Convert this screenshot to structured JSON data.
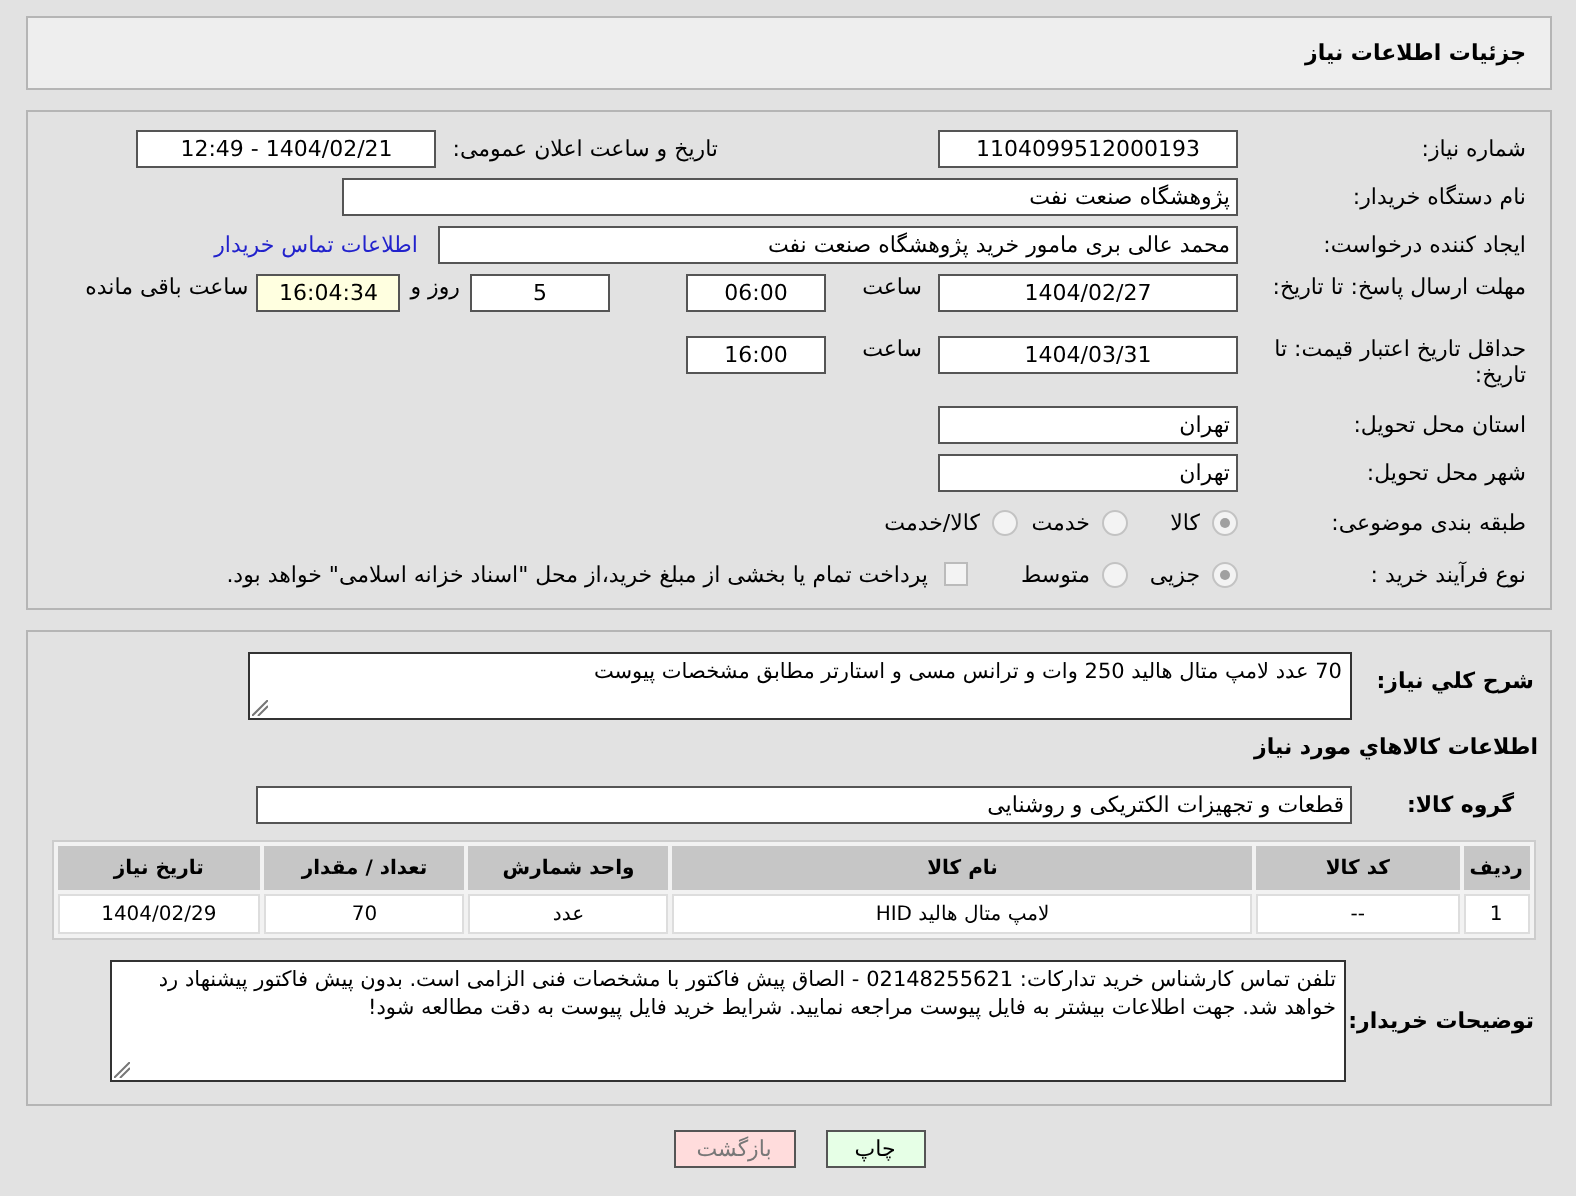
{
  "header": {
    "title": "جزئیات اطلاعات نیاز"
  },
  "form": {
    "need_number": {
      "label": "شماره نیاز:",
      "value": "1104099512000193"
    },
    "announce": {
      "label": "تاریخ و ساعت اعلان عمومی:",
      "value": "1404/02/21 - 12:49"
    },
    "buyer_org": {
      "label": "نام دستگاه خریدار:",
      "value": "پژوهشگاه صنعت نفت"
    },
    "creator": {
      "label": "ایجاد کننده درخواست:",
      "value": "محمد عالی بری مامور خرید پژوهشگاه صنعت نفت",
      "link": "اطلاعات تماس خریدار"
    },
    "deadline": {
      "label": "مهلت ارسال پاسخ: تا تاریخ:",
      "date": "1404/02/27",
      "time_label": "ساعت",
      "time": "06:00",
      "days": "5",
      "days_label": "روز و",
      "remaining": "16:04:34",
      "remaining_label": "ساعت باقی مانده"
    },
    "validity": {
      "label": "حداقل تاریخ اعتبار قیمت: تا تاریخ:",
      "date": "1404/03/31",
      "time_label": "ساعت",
      "time": "16:00"
    },
    "province": {
      "label": "استان محل تحویل:",
      "value": "تهران"
    },
    "city": {
      "label": "شهر محل تحویل:",
      "value": "تهران"
    },
    "category": {
      "label": "طبقه بندی موضوعی:",
      "options": [
        {
          "label": "کالا",
          "selected": true
        },
        {
          "label": "خدمت",
          "selected": false
        },
        {
          "label": "کالا/خدمت",
          "selected": false
        }
      ]
    },
    "process": {
      "label": "نوع فرآیند خرید :",
      "options": [
        {
          "label": "جزیی",
          "selected": true
        },
        {
          "label": "متوسط",
          "selected": false
        }
      ],
      "payment": {
        "label": "پرداخت تمام یا بخشی از مبلغ خرید،از محل \"اسناد خزانه اسلامی\" خواهد بود.",
        "checked": false
      }
    }
  },
  "details": {
    "summary": {
      "label": "شرح کلي نياز:",
      "value": "70 عدد لامپ متال هالید 250 وات و ترانس مسی و استارتر مطابق مشخصات پیوست"
    },
    "goods_heading": "اطلاعات کالاهاي مورد نياز",
    "group": {
      "label": "گروه کالا:",
      "value": "قطعات و تجهیزات الکتریکی و روشنایی"
    },
    "table": {
      "columns": [
        "ردیف",
        "کد کالا",
        "نام کالا",
        "واحد شمارش",
        "تعداد / مقدار",
        "تاریخ نیاز"
      ],
      "rows": [
        [
          "1",
          "--",
          "لامپ متال هالید HID",
          "عدد",
          "70",
          "1404/02/29"
        ]
      ]
    },
    "buyer_notes": {
      "label": "توضیحات خریدار:",
      "value": "تلفن تماس کارشناس خرید تدارکات: 02148255621 - الصاق پیش فاکتور با مشخصات فنی الزامی است. بدون پیش فاکتور پیشنهاد رد خواهد شد. جهت اطلاعات بیشتر به فایل پیوست مراجعه نمایید. شرایط خرید فایل پیوست به دقت مطالعه شود!"
    }
  },
  "buttons": [
    {
      "kind": "print",
      "label": "چاپ"
    },
    {
      "kind": "back",
      "label": "بازگشت"
    }
  ]
}
